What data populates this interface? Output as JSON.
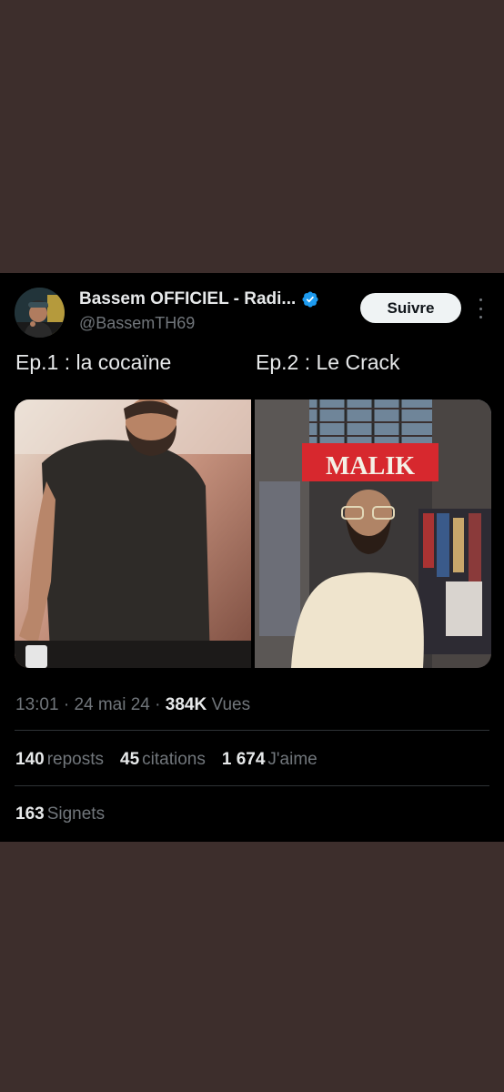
{
  "tweet": {
    "author_name": "Bassem OFFICIEL - Radi...",
    "handle": "@BassemTH69",
    "follow_label": "Suivre",
    "ep1_label": "Ep.1 : la cocaïne",
    "ep2_label": "Ep.2 : Le Crack",
    "shop_sign": "MALIK",
    "time": "13:01",
    "date": "24 mai 24",
    "views_count": "384K",
    "views_label": "Vues",
    "reposts_count": "140",
    "reposts_label": "reposts",
    "quotes_count": "45",
    "quotes_label": "citations",
    "likes_count": "1 674",
    "likes_label": "J'aime",
    "bookmarks_count": "163",
    "bookmarks_label": "Signets",
    "separator": "·"
  },
  "colors": {
    "background": "#3d2e2c",
    "tweet_bg": "#000000",
    "text_primary": "#e7e9ea",
    "text_secondary": "#71767b",
    "verified": "#1d9bf0",
    "divider": "#2f3336"
  },
  "icons": {
    "verified": "verified-badge-icon",
    "more": "more-options-icon"
  }
}
